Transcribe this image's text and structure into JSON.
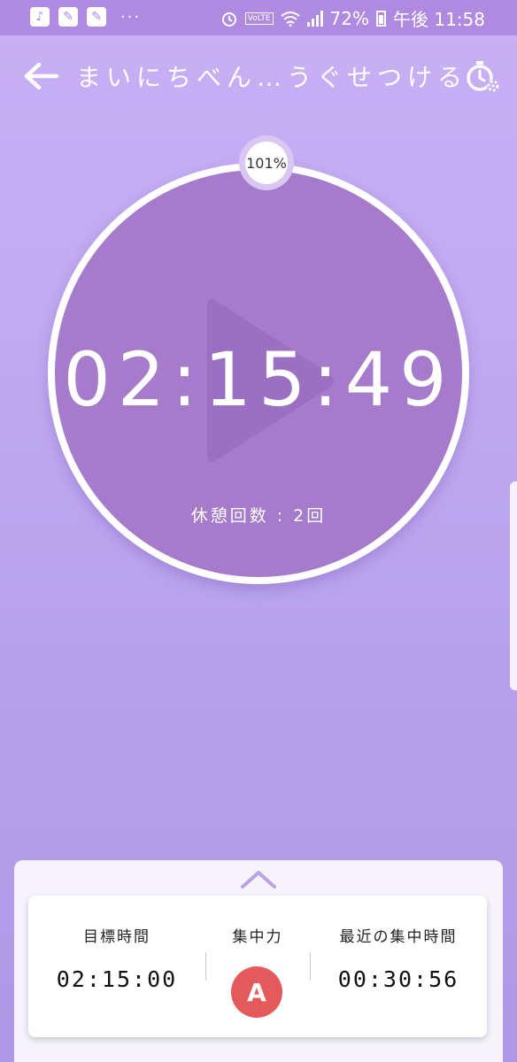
{
  "status_bar": {
    "more_indicator": "···",
    "battery": "72%",
    "time": "午後 11:58",
    "volte": "VoLTE"
  },
  "header": {
    "title": "まいにちべん…うぐせつける"
  },
  "timer": {
    "progress_label": "101%",
    "elapsed": "02:15:49",
    "break_count": "休憩回数 : 2回"
  },
  "stats": {
    "goal_label": "目標時間",
    "goal_value": "02:15:00",
    "focus_label": "集中力",
    "focus_grade": "A",
    "recent_label": "最近の集中時間",
    "recent_value": "00:30:56"
  },
  "colors": {
    "status_bar": "#b08ae0",
    "background_top": "#c9b0f5",
    "timer_face": "#a67bcb",
    "grade_badge": "#e45a5a"
  },
  "icons": {
    "back": "arrow-left-icon",
    "settings": "stopwatch-gear-icon",
    "expand": "chevron-up-icon",
    "watermark": "play-icon"
  }
}
